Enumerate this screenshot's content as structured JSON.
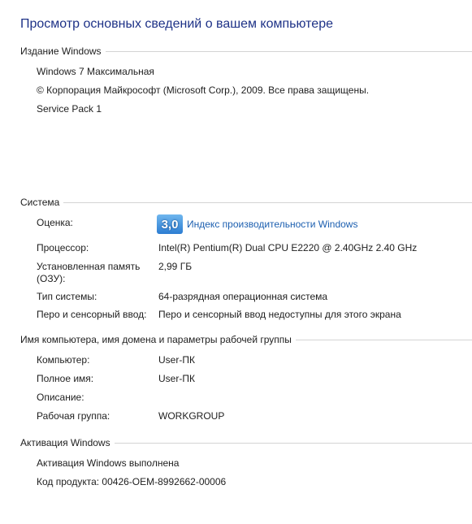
{
  "title": "Просмотр основных сведений о вашем компьютере",
  "edition": {
    "header": "Издание Windows",
    "name": "Windows 7 Максимальная",
    "copyright": "© Корпорация Майкрософт (Microsoft Corp.), 2009. Все права защищены.",
    "service_pack": "Service Pack 1"
  },
  "system": {
    "header": "Система",
    "rating_label": "Оценка:",
    "rating_score": "3,0",
    "rating_link": "Индекс производительности Windows",
    "processor_label": "Процессор:",
    "processor_value": "Intel(R) Pentium(R) Dual  CPU  E2220  @ 2.40GHz   2.40 GHz",
    "memory_label_1": "Установленная память",
    "memory_label_2": "(ОЗУ):",
    "memory_value": "2,99 ГБ",
    "type_label": "Тип системы:",
    "type_value": "64-разрядная операционная система",
    "pen_label": "Перо и сенсорный ввод:",
    "pen_value": "Перо и сенсорный ввод недоступны для этого экрана"
  },
  "computer": {
    "header": "Имя компьютера, имя домена и параметры рабочей группы",
    "computer_label": "Компьютер:",
    "computer_value": "User-ПК",
    "fullname_label": "Полное имя:",
    "fullname_value": "User-ПК",
    "description_label": "Описание:",
    "workgroup_label": "Рабочая группа:",
    "workgroup_value": "WORKGROUP"
  },
  "activation": {
    "header": "Активация Windows",
    "status": "Активация Windows выполнена",
    "product_key_label": "Код продукта:",
    "product_key_value": "00426-OEM-8992662-00006"
  }
}
